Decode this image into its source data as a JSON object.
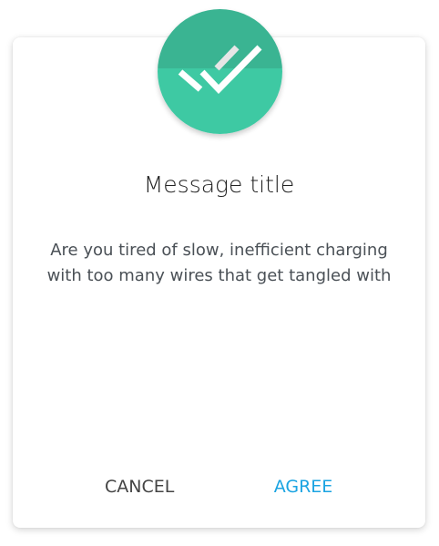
{
  "dialog": {
    "icon": "double-check-icon",
    "title": "Message title",
    "message": "Are you tired of slow, inefficient charging with too many wires that get tangled with",
    "cancel_label": "CANCEL",
    "agree_label": "AGREE"
  },
  "colors": {
    "badge_top": "#3ab492",
    "badge_bottom": "#3ec9a3",
    "accent": "#1ba4e2"
  }
}
